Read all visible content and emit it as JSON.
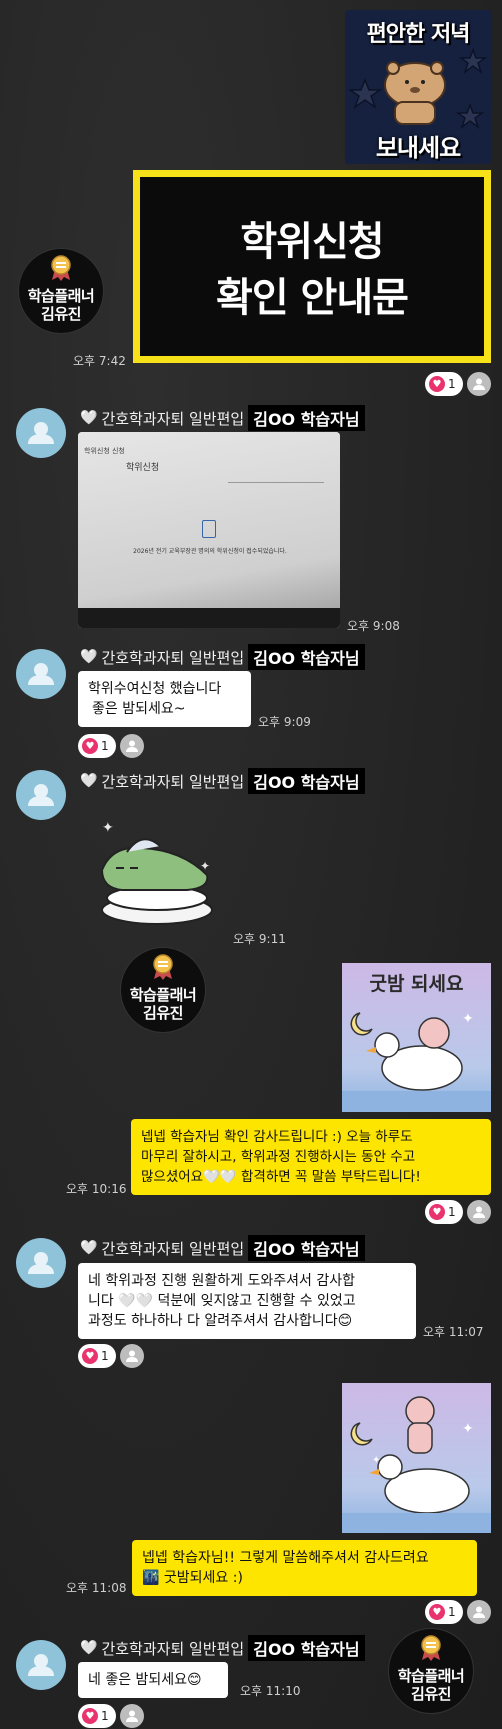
{
  "header_image": {
    "line1": "편안한 저녁",
    "line2": "보내세요"
  },
  "notice_image": {
    "line1": "학위신청",
    "line2": "확인 안내문"
  },
  "planner": {
    "line1": "학습플래너",
    "line2": "김유진"
  },
  "sender": {
    "prefix": "간호학과자퇴 일반편입",
    "name": "김OO 학습자님"
  },
  "messages": {
    "m1_time": "오후 7:42",
    "m1_react": "1",
    "photo": {
      "breadcrumb": "학위신청 신청",
      "heading": "학위신청",
      "notice": "2026년 전기 교육부장관 명의의 학위신청이 접수되었습니다.",
      "time": "오후 9:08"
    },
    "m2_line1": "학위수여신청 했습니다",
    "m2_line2": "좋은 밤되세요~",
    "m2_time": "오후 9:09",
    "m2_react": "1",
    "sticker_time": "오후 9:11",
    "goodnight_sticker": "굿밤 되세요",
    "m3_line1": "넵넵 학습자님 확인 감사드립니다 :) 오늘 하루도",
    "m3_line2": "마무리 잘하시고, 학위과정 진행하시는 동안 수고",
    "m3_line3": "많으셨어요🤍🤍 합격하면 꼭 말씀 부탁드립니다!",
    "m3_time": "오후 10:16",
    "m3_react": "1",
    "m4_line1": "네 학위과정 진행 원활하게 도와주셔서 감사합",
    "m4_line2": "니다 🤍🤍 덕분에 잊지않고 진행할 수 있었고",
    "m4_line3": "과정도 하나하나 다 알려주셔서 감사합니다😊",
    "m4_time": "오후 11:07",
    "m4_react": "1",
    "m5_line1": "넵넵 학습자님!! 그렇게 말씀해주셔서 감사드려요",
    "m5_line2": "🌃 굿밤되세요 :)",
    "m5_time": "오후 11:08",
    "m5_react": "1",
    "m6_text": "네 좋은 밤되세요😊",
    "m6_time": "오후 11:10",
    "m6_react": "1"
  },
  "colors": {
    "background": "#262626",
    "yellow_bubble": "#fee500",
    "heart_badge": "#e8336e"
  }
}
